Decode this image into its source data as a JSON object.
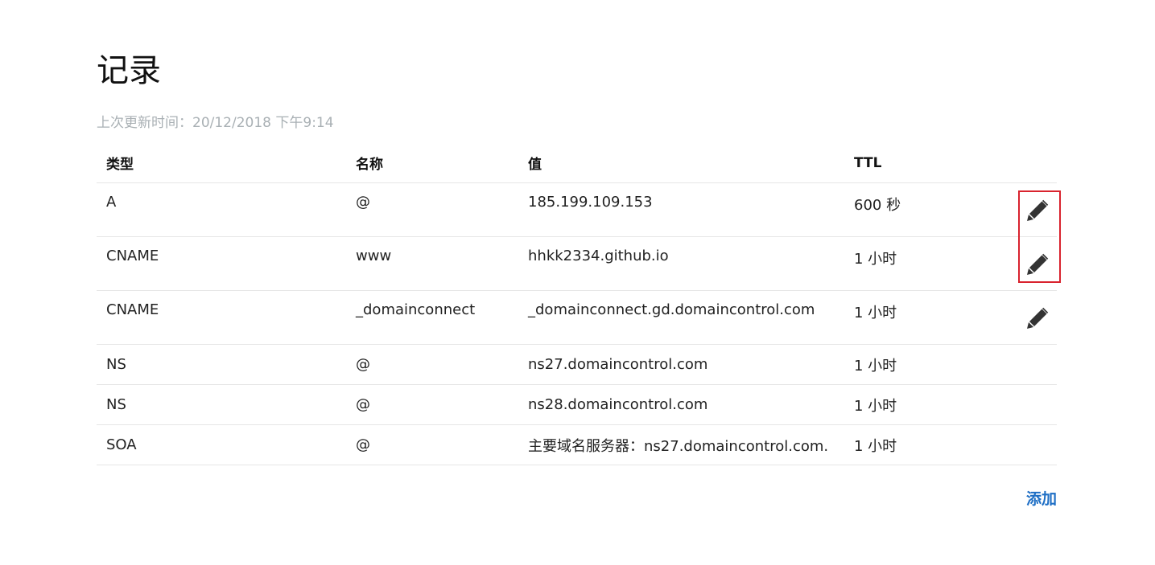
{
  "page": {
    "title": "记录",
    "last_updated": "上次更新时间：20/12/2018 下午9:14"
  },
  "table": {
    "headers": {
      "type": "类型",
      "name": "名称",
      "value": "值",
      "ttl": "TTL"
    },
    "rows": [
      {
        "type": "A",
        "name": "@",
        "value": "185.199.109.153",
        "ttl": "600 秒",
        "editable": true
      },
      {
        "type": "CNAME",
        "name": "www",
        "value": "hhkk2334.github.io",
        "ttl": "1 小时",
        "editable": true
      },
      {
        "type": "CNAME",
        "name": "_domainconnect",
        "value": "_domainconnect.gd.domaincontrol.com",
        "ttl": "1 小时",
        "editable": true
      },
      {
        "type": "NS",
        "name": "@",
        "value": "ns27.domaincontrol.com",
        "ttl": "1 小时",
        "editable": false
      },
      {
        "type": "NS",
        "name": "@",
        "value": "ns28.domaincontrol.com",
        "ttl": "1 小时",
        "editable": false
      },
      {
        "type": "SOA",
        "name": "@",
        "value": "主要域名服务器：ns27.domaincontrol.com.",
        "ttl": "1 小时",
        "editable": false
      }
    ]
  },
  "actions": {
    "add_label": "添加",
    "edit_icon": "pencil-icon"
  },
  "colors": {
    "link": "#1f6fc5",
    "muted_text": "#a9b0b4",
    "highlight": "#d9232e",
    "icon": "#333333"
  }
}
